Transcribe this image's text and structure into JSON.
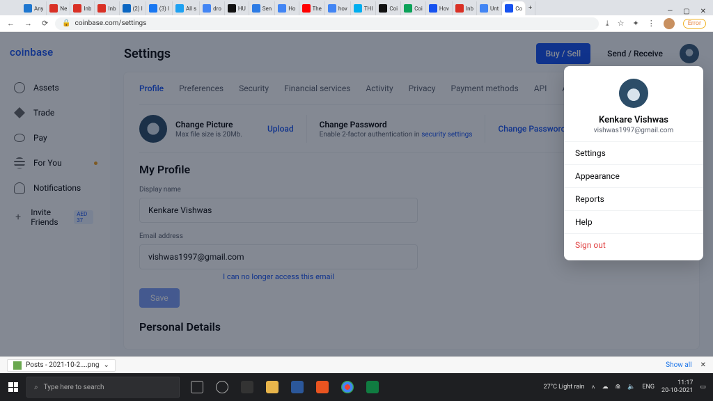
{
  "browser": {
    "tabs": [
      {
        "label": "Any",
        "color": "#1e77d0"
      },
      {
        "label": "Ne",
        "color": "#d93025"
      },
      {
        "label": "Inb",
        "color": "#d93025"
      },
      {
        "label": "Inb",
        "color": "#d93025"
      },
      {
        "label": "(2) I",
        "color": "#0a66c2"
      },
      {
        "label": "(3) I",
        "color": "#1877f2"
      },
      {
        "label": "All s",
        "color": "#1da1f2"
      },
      {
        "label": "dro",
        "color": "#4285f4"
      },
      {
        "label": "HU",
        "color": "#111"
      },
      {
        "label": "Sen",
        "color": "#2c7be5"
      },
      {
        "label": "Ho",
        "color": "#4285f4"
      },
      {
        "label": "The",
        "color": "#f00"
      },
      {
        "label": "hov",
        "color": "#4285f4"
      },
      {
        "label": "THI",
        "color": "#00aeef"
      },
      {
        "label": "Coi",
        "color": "#111"
      },
      {
        "label": "Coi",
        "color": "#0ba259"
      },
      {
        "label": "Hov",
        "color": "#1652f0"
      },
      {
        "label": "Inb",
        "color": "#d93025"
      },
      {
        "label": "Unt",
        "color": "#4285f4"
      },
      {
        "label": "Co",
        "color": "#1652f0",
        "active": true
      }
    ],
    "url": "coinbase.com/settings",
    "error_label": "Error"
  },
  "sidebar": {
    "logo": "coinbase",
    "items": [
      {
        "label": "Assets"
      },
      {
        "label": "Trade"
      },
      {
        "label": "Pay"
      },
      {
        "label": "For You",
        "dot": true
      },
      {
        "label": "Notifications"
      },
      {
        "label": "Invite Friends",
        "badge": "AED 37"
      }
    ]
  },
  "header": {
    "title": "Settings",
    "buy_sell": "Buy / Sell",
    "send_receive": "Send / Receive"
  },
  "settings_tabs": [
    "Profile",
    "Preferences",
    "Security",
    "Financial services",
    "Activity",
    "Privacy",
    "Payment methods",
    "API",
    "Account"
  ],
  "row": {
    "change_picture_title": "Change Picture",
    "change_picture_sub": "Max file size is 20Mb.",
    "upload": "Upload",
    "change_password_title": "Change Password",
    "change_password_sub": "Enable 2-factor authentication in ",
    "security_link": "security settings",
    "change_password_action": "Change Password"
  },
  "profile": {
    "section": "My Profile",
    "display_label": "Display name",
    "display_value": "Kenkare Vishwas",
    "email_label": "Email address",
    "email_value": "vishwas1997@gmail.com",
    "no_access": "I can no longer access this email",
    "save": "Save",
    "personal": "Personal Details"
  },
  "popover": {
    "name": "Kenkare Vishwas",
    "email": "vishwas1997@gmail.com",
    "items": [
      "Settings",
      "Appearance",
      "Reports",
      "Help"
    ],
    "signout": "Sign out"
  },
  "download": {
    "file": "Posts - 2021-10-2....png",
    "show_all": "Show all"
  },
  "taskbar": {
    "search_placeholder": "Type here to search",
    "weather": "27°C  Light rain",
    "lang": "ENG",
    "time": "11:17",
    "date": "20-10-2021"
  }
}
